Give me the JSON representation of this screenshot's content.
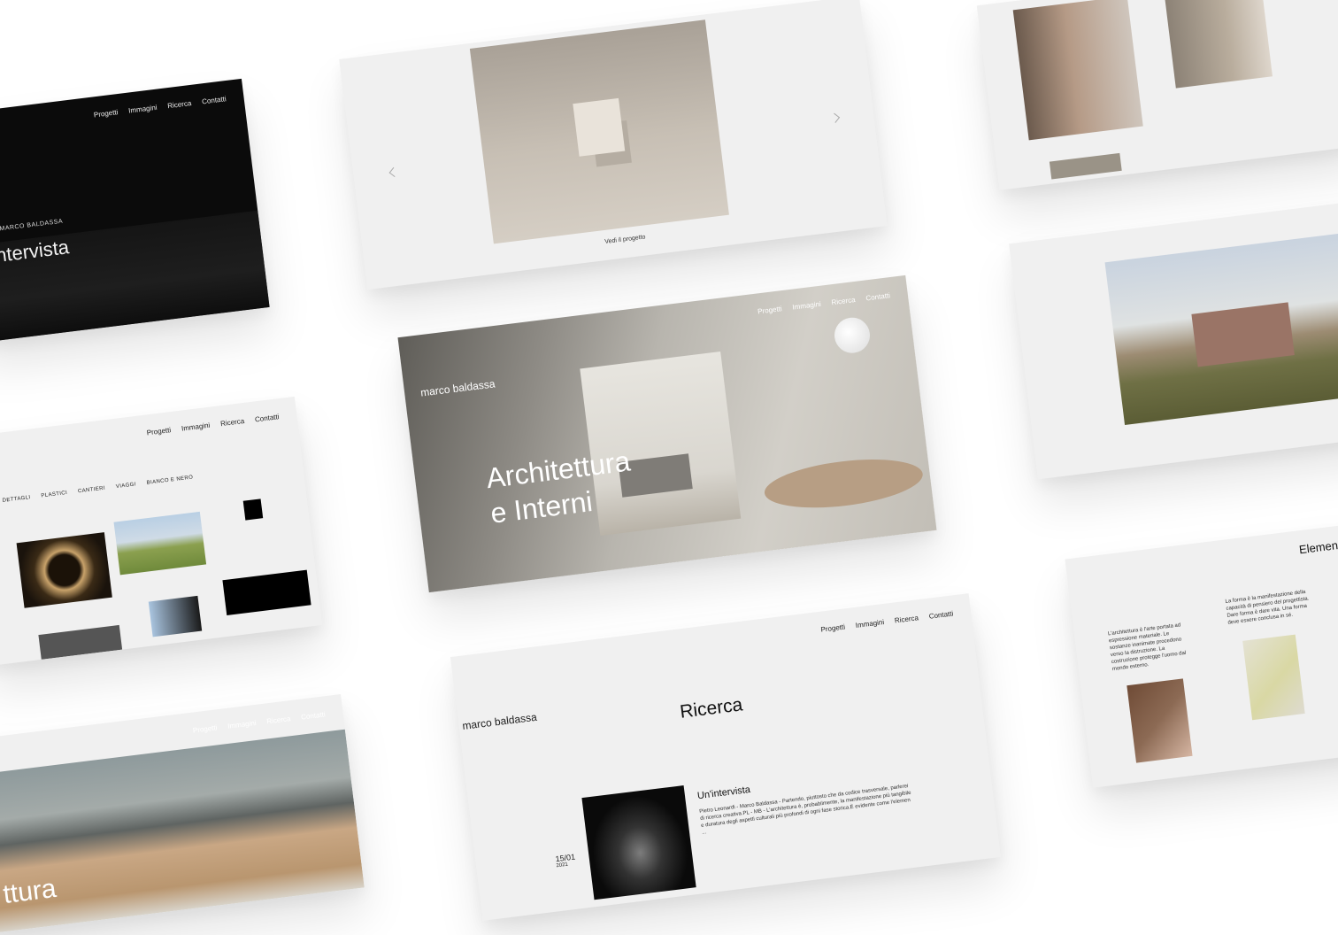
{
  "brand": "marco baldassa",
  "brand_upper": "MARCO BALDASSA",
  "nav": [
    "Progetti",
    "Immagini",
    "Ricerca",
    "Contatti"
  ],
  "intervista_card": {
    "title": "ntervista"
  },
  "model_card": {
    "link": "Vedi il progetto"
  },
  "hero_card": {
    "title_line1": "Architettura",
    "title_line2": "e Interni"
  },
  "gallery_card": {
    "filters": [
      "I",
      "DETTAGLI",
      "PLASTICI",
      "CANTIERI",
      "VIAGGI",
      "BIANCO E NERO"
    ]
  },
  "bottom_left_card": {
    "title": "ttura"
  },
  "ricerca_card": {
    "title": "Ricerca",
    "post": {
      "day": "15/01",
      "year": "2021",
      "title": "Un'intervista",
      "excerpt": "Pietro Leonardi - Marco Baldassa - Partendo, piuttosto che da codice trasversale, parlerei di ricerca creativa.PL - MB - L'architettura è, probabilmente, la manifestazione più tangibile e duratura degli aspetti culturali più profondi di ogni fase storica.È evidente come l'elemen ..."
    }
  },
  "elements_card": {
    "title": "Elemen",
    "text_left": "L'architettura è l'arte portata ad espressione materiale. Le sostanze inanimate procedono verso la distruzione. La costruzione protegge l'uomo dal mondo esterno.",
    "text_right": "La forma è la manifestazione della capacità di pensiero del progettista. Dare forma è dare vita. Una forma deve essere conclusa in sé."
  },
  "colors": {
    "page_bg": "#ffffff",
    "card_light": "#f0f0f0",
    "card_dark": "#0b0b0b"
  }
}
